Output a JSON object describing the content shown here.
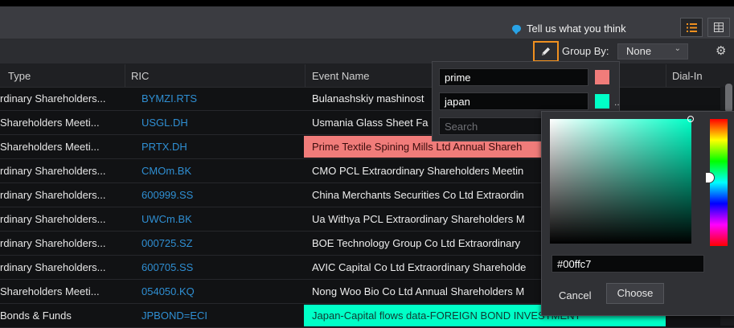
{
  "toolbar": {
    "feedback_label": "Tell us what you think",
    "group_by_label": "Group By:",
    "group_by_value": "None"
  },
  "columns": [
    "Type",
    "RIC",
    "Event Name",
    "Dial-In"
  ],
  "rows": [
    {
      "type": "rdinary Shareholders...",
      "ric": "BYMZI.RTS",
      "event": "Bulanashskiy mashinost",
      "highlight": null
    },
    {
      "type": "Shareholders Meeti...",
      "ric": "USGL.DH",
      "event": "Usmania Glass Sheet Fa",
      "highlight": null
    },
    {
      "type": "Shareholders Meeti...",
      "ric": "PRTX.DH",
      "event": "Prime Textile Spining Mills Ltd Annual Shareh",
      "highlight": "#f07c7a"
    },
    {
      "type": "rdinary Shareholders...",
      "ric": "CMOm.BK",
      "event": "CMO PCL Extraordinary Shareholders Meetin",
      "highlight": null
    },
    {
      "type": "rdinary Shareholders...",
      "ric": "600999.SS",
      "event": "China Merchants Securities Co Ltd Extraordin",
      "highlight": null
    },
    {
      "type": "rdinary Shareholders...",
      "ric": "UWCm.BK",
      "event": "Ua Withya PCL Extraordinary Shareholders M",
      "highlight": null
    },
    {
      "type": "rdinary Shareholders...",
      "ric": "000725.SZ",
      "event": "BOE Technology Group Co Ltd Extraordinary",
      "highlight": null
    },
    {
      "type": "rdinary Shareholders...",
      "ric": "600705.SS",
      "event": "AVIC Capital Co Ltd Extraordinary Shareholde",
      "highlight": null
    },
    {
      "type": "Shareholders Meeti...",
      "ric": "054050.KQ",
      "event": "Nong Woo Bio Co Ltd Annual Shareholders M",
      "highlight": null
    },
    {
      "type": "Bonds & Funds",
      "ric": "JPBOND=ECI",
      "event": "Japan-Capital flows data-FOREIGN BOND INVESTMENT",
      "highlight": "#00ffc7"
    }
  ],
  "highlight_popover": {
    "tags": [
      {
        "text": "prime",
        "color": "#f07c7a"
      },
      {
        "text": "japan",
        "color": "#00ffc7"
      }
    ],
    "search_placeholder": "Search",
    "overflow_marker": ".."
  },
  "color_picker": {
    "hex_value": "#00ffc7",
    "cancel_label": "Cancel",
    "choose_label": "Choose"
  }
}
